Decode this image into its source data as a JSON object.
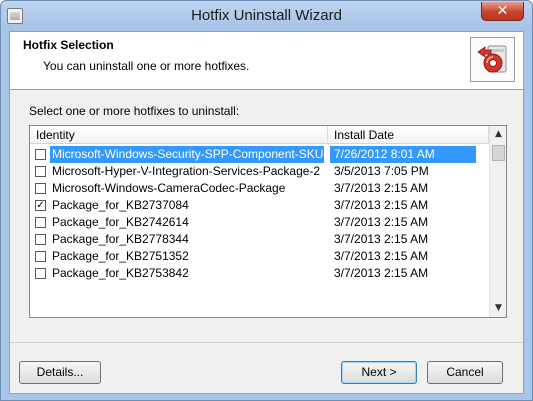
{
  "window": {
    "title": "Hotfix Uninstall Wizard",
    "close_glyph": "✕"
  },
  "header": {
    "title": "Hotfix Selection",
    "subtitle": "You can uninstall one or more hotfixes.",
    "icon": "uninstall-wizard-icon"
  },
  "instruction": "Select one or more hotfixes to uninstall:",
  "list": {
    "columns": [
      "Identity",
      "Install Date"
    ],
    "rows": [
      {
        "identity": "Microsoft-Windows-Security-SPP-Component-SKU-Enter...",
        "date": "7/26/2012 8:01 AM",
        "checked": false,
        "selected": true
      },
      {
        "identity": "Microsoft-Hyper-V-Integration-Services-Package-2",
        "date": "3/5/2013 7:05 PM",
        "checked": false,
        "selected": false
      },
      {
        "identity": "Microsoft-Windows-CameraCodec-Package",
        "date": "3/7/2013 2:15 AM",
        "checked": false,
        "selected": false
      },
      {
        "identity": "Package_for_KB2737084",
        "date": "3/7/2013 2:15 AM",
        "checked": true,
        "selected": false
      },
      {
        "identity": "Package_for_KB2742614",
        "date": "3/7/2013 2:15 AM",
        "checked": false,
        "selected": false
      },
      {
        "identity": "Package_for_KB2778344",
        "date": "3/7/2013 2:15 AM",
        "checked": false,
        "selected": false
      },
      {
        "identity": "Package_for_KB2751352",
        "date": "3/7/2013 2:15 AM",
        "checked": false,
        "selected": false
      },
      {
        "identity": "Package_for_KB2753842",
        "date": "3/7/2013 2:15 AM",
        "checked": false,
        "selected": false
      }
    ],
    "check_glyph": "✓"
  },
  "buttons": {
    "details": "Details...",
    "next": "Next >",
    "cancel": "Cancel"
  },
  "colors": {
    "selection": "#3399ff",
    "close_button": "#c7442f",
    "titlebar": "#a9c5e8"
  }
}
